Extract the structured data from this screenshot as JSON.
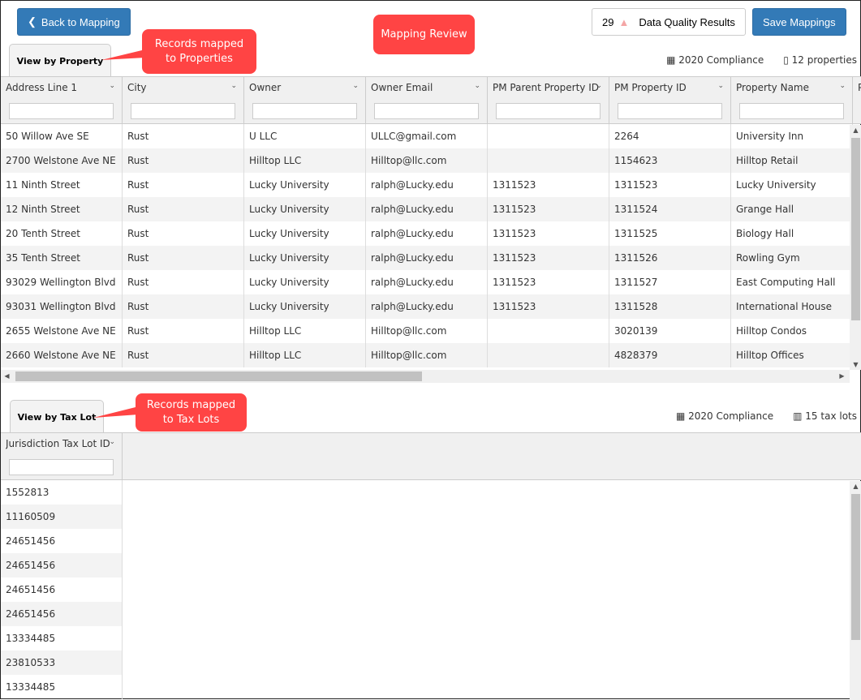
{
  "toolbar": {
    "back_label": "Back to Mapping",
    "dq_count": "29",
    "dq_label": "Data Quality Results",
    "save_label": "Save Mappings",
    "title_callout": "Mapping Review"
  },
  "property": {
    "tab": "View by Property",
    "callout": "Records mapped to Properties",
    "cycle": "2020 Compliance",
    "count": "12 properties",
    "columns": [
      "Address Line 1",
      "City",
      "Owner",
      "Owner Email",
      "PM Parent Property ID",
      "PM Property ID",
      "Property Name",
      "P"
    ],
    "rows": [
      [
        "50 Willow Ave SE",
        "Rust",
        "U LLC",
        "ULLC@gmail.com",
        "",
        "2264",
        "University Inn"
      ],
      [
        "2700 Welstone Ave NE",
        "Rust",
        "Hilltop LLC",
        "Hilltop@llc.com",
        "",
        "1154623",
        "Hilltop Retail"
      ],
      [
        "11 Ninth Street",
        "Rust",
        "Lucky University",
        "ralph@Lucky.edu",
        "1311523",
        "1311523",
        "Lucky University"
      ],
      [
        "12 Ninth Street",
        "Rust",
        "Lucky University",
        "ralph@Lucky.edu",
        "1311523",
        "1311524",
        "Grange Hall"
      ],
      [
        "20 Tenth Street",
        "Rust",
        "Lucky University",
        "ralph@Lucky.edu",
        "1311523",
        "1311525",
        "Biology Hall"
      ],
      [
        "35 Tenth Street",
        "Rust",
        "Lucky University",
        "ralph@Lucky.edu",
        "1311523",
        "1311526",
        "Rowling Gym"
      ],
      [
        "93029 Wellington Blvd",
        "Rust",
        "Lucky University",
        "ralph@Lucky.edu",
        "1311523",
        "1311527",
        "East Computing Hall"
      ],
      [
        "93031 Wellington Blvd",
        "Rust",
        "Lucky University",
        "ralph@Lucky.edu",
        "1311523",
        "1311528",
        "International House"
      ],
      [
        "2655 Welstone Ave NE",
        "Rust",
        "Hilltop LLC",
        "Hilltop@llc.com",
        "",
        "3020139",
        "Hilltop Condos"
      ],
      [
        "2660 Welstone Ave NE",
        "Rust",
        "Hilltop LLC",
        "Hilltop@llc.com",
        "",
        "4828379",
        "Hilltop Offices"
      ]
    ]
  },
  "taxlot": {
    "tab": "View by Tax Lot",
    "callout": "Records mapped to Tax Lots",
    "cycle": "2020 Compliance",
    "count": "15 tax lots",
    "columns": [
      "Jurisdiction Tax Lot ID"
    ],
    "rows": [
      "1552813",
      "11160509",
      "24651456",
      "24651456",
      "24651456",
      "24651456",
      "13334485",
      "23810533",
      "13334485"
    ]
  },
  "icons": {
    "back": "chevron-left-icon",
    "warning": "warning-icon",
    "calendar": "calendar-icon",
    "building": "building-icon",
    "map": "map-icon"
  },
  "colors": {
    "primary": "#337ab7",
    "callout": "#ff4444",
    "warning": "#f4a6a6"
  }
}
